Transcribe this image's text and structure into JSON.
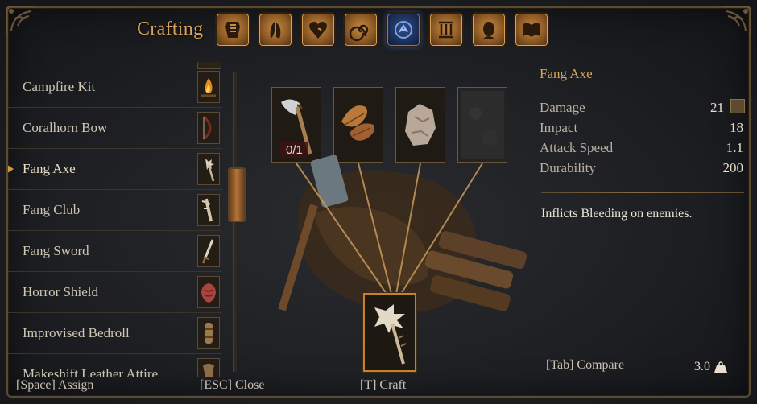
{
  "header": {
    "title": "Crafting",
    "tabs": [
      {
        "icon": "armor-icon"
      },
      {
        "icon": "feather-shield-icon"
      },
      {
        "icon": "heart-icon"
      },
      {
        "icon": "swirl-icon"
      },
      {
        "icon": "rune-circle-icon",
        "active": true
      },
      {
        "icon": "pillars-icon"
      },
      {
        "icon": "face-icon"
      },
      {
        "icon": "book-icon"
      }
    ]
  },
  "recipes": [
    {
      "label": "Campfire Kit",
      "icon": "campfire-icon"
    },
    {
      "label": "Coralhorn Bow",
      "icon": "bow-icon"
    },
    {
      "label": "Fang Axe",
      "icon": "fang-axe-icon",
      "selected": true
    },
    {
      "label": "Fang Club",
      "icon": "fang-club-icon"
    },
    {
      "label": "Fang Sword",
      "icon": "fang-sword-icon"
    },
    {
      "label": "Horror Shield",
      "icon": "horror-shield-icon"
    },
    {
      "label": "Improvised Bedroll",
      "icon": "bedroll-icon"
    },
    {
      "label": "Makeshift Leather Attire",
      "icon": "leather-attire-icon"
    }
  ],
  "ingredients": [
    {
      "icon": "axe-icon",
      "count": "0/1"
    },
    {
      "icon": "leaves-icon",
      "count": ""
    },
    {
      "icon": "stone-icon",
      "count": ""
    },
    {
      "icon": "empty-slot-icon",
      "count": ""
    }
  ],
  "result": {
    "icon": "fang-axe-icon"
  },
  "item": {
    "name": "Fang Axe",
    "stats": [
      {
        "label": "Damage",
        "value": "21"
      },
      {
        "label": "Impact",
        "value": "18"
      },
      {
        "label": "Attack Speed",
        "value": "1.1"
      },
      {
        "label": "Durability",
        "value": "200"
      }
    ],
    "description": "Inflicts Bleeding on enemies."
  },
  "footer": {
    "compare": "[Tab] Compare",
    "weight": "3.0",
    "assign": "[Space] Assign",
    "close": "[ESC] Close",
    "craft": "[T] Craft"
  },
  "colors": {
    "accent": "#d5a35e",
    "active_tab": "#2f4e89",
    "background": "#1d1f23"
  }
}
